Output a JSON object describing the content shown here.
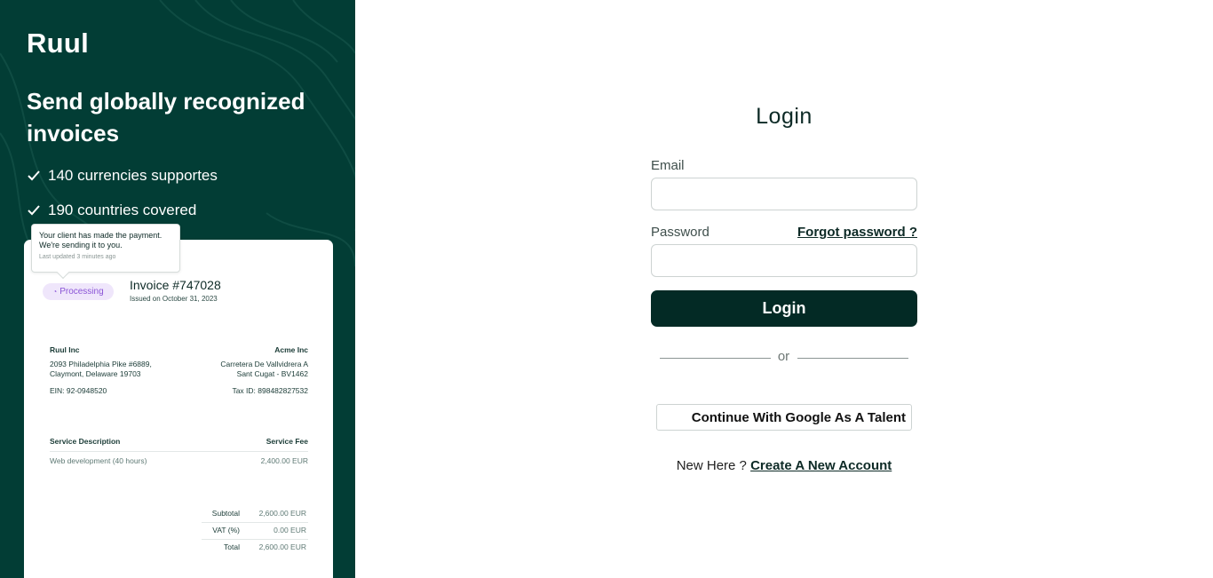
{
  "left_panel": {
    "brand": "Ruul",
    "headline": "Send globally recognized invoices",
    "features": [
      "140 currencies supportes",
      "190 countries covered"
    ],
    "tooltip": {
      "message": "Your client has made the payment. We're sending it to you.",
      "updated": "Last updated 3 minutes ago"
    },
    "invoice": {
      "status": "Processing",
      "number": "Invoice #747028",
      "issued": "Issued on October 31, 2023",
      "from": {
        "name": "Ruul Inc",
        "address_1": "2093 Philadelphia Pike #6889,",
        "address_2": "Claymont, Delaware 19703",
        "tax": "EIN: 92-0948520"
      },
      "to": {
        "name": "Acme Inc",
        "address_1": "Carretera De Vallvidrera A",
        "address_2": "Sant Cugat - BV1462",
        "tax": "Tax ID: 898482827532"
      },
      "col_desc": "Service Description",
      "col_fee": "Service Fee",
      "line_desc": "Web development (40 hours)",
      "line_fee": "2,400.00 EUR",
      "subtotal_label": "Subtotal",
      "subtotal_value": "2,600.00 EUR",
      "vat_label": "VAT (%)",
      "vat_value": "0.00 EUR",
      "total_label": "Total",
      "total_value": "2,600.00 EUR"
    }
  },
  "login": {
    "title": "Login",
    "email_label": "Email",
    "email_value": "",
    "password_label": "Password",
    "password_value": "",
    "forgot": "Forgot password ?",
    "submit": "Login",
    "or": "or",
    "google": "Continue With Google As A Talent",
    "new_here": "New Here ?",
    "create_account": "Create A New Account"
  },
  "colors": {
    "panel_bg": "#023d35",
    "button_bg": "#032a25",
    "badge_bg": "#efe6fb",
    "badge_text": "#8a54d6"
  },
  "icons": [
    "check-icon",
    "processing-icon"
  ]
}
